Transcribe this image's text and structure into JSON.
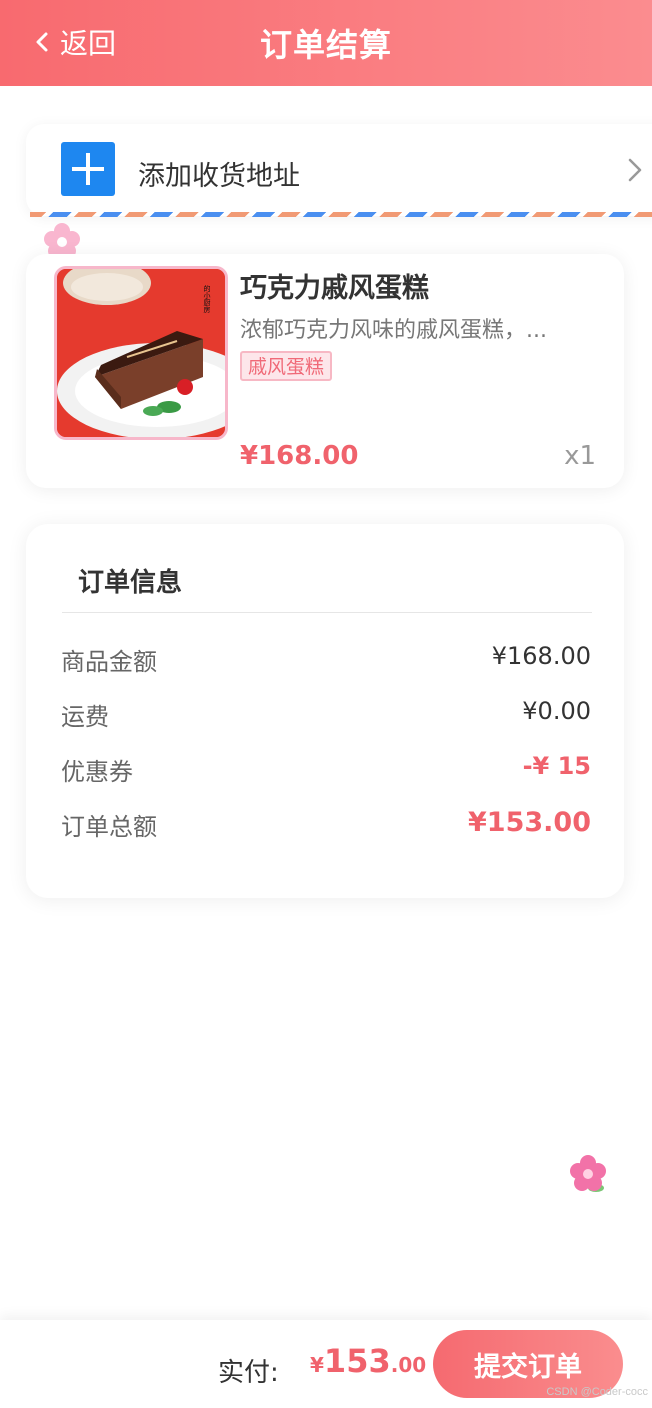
{
  "header": {
    "back_label": "返回",
    "title": "订单结算"
  },
  "address": {
    "add_label": "添加收货地址"
  },
  "product": {
    "name": "巧克力戚风蛋糕",
    "description": "浓郁巧克力风味的戚风蛋糕，...",
    "tag": "戚风蛋糕",
    "price": "¥168.00",
    "quantity": "x1",
    "image_brand_text": "的小厨房"
  },
  "order_info": {
    "title": "订单信息",
    "rows": [
      {
        "label": "商品金额",
        "value": "¥168.00"
      },
      {
        "label": "运费",
        "value": "¥0.00"
      },
      {
        "label": "优惠券",
        "value": "-¥ 15"
      },
      {
        "label": "订单总额",
        "value": "¥153.00"
      }
    ]
  },
  "footer": {
    "pay_label": "实付:",
    "pay_symbol": "¥",
    "pay_integer": "153",
    "pay_decimal": ".00",
    "submit_label": "提交订单"
  },
  "watermark": "CSDN @Coder-cocc",
  "colors": {
    "header_start": "#f86a6f",
    "header_end": "#fb8c8f",
    "price_red": "#f0626c",
    "add_icon_blue": "#1e87f0",
    "tag_pink": "#f06a78"
  },
  "icons": {
    "back": "chevron-left-icon",
    "add": "plus-icon",
    "address_arrow": "chevron-right-icon",
    "decoration": "flower-icon"
  }
}
